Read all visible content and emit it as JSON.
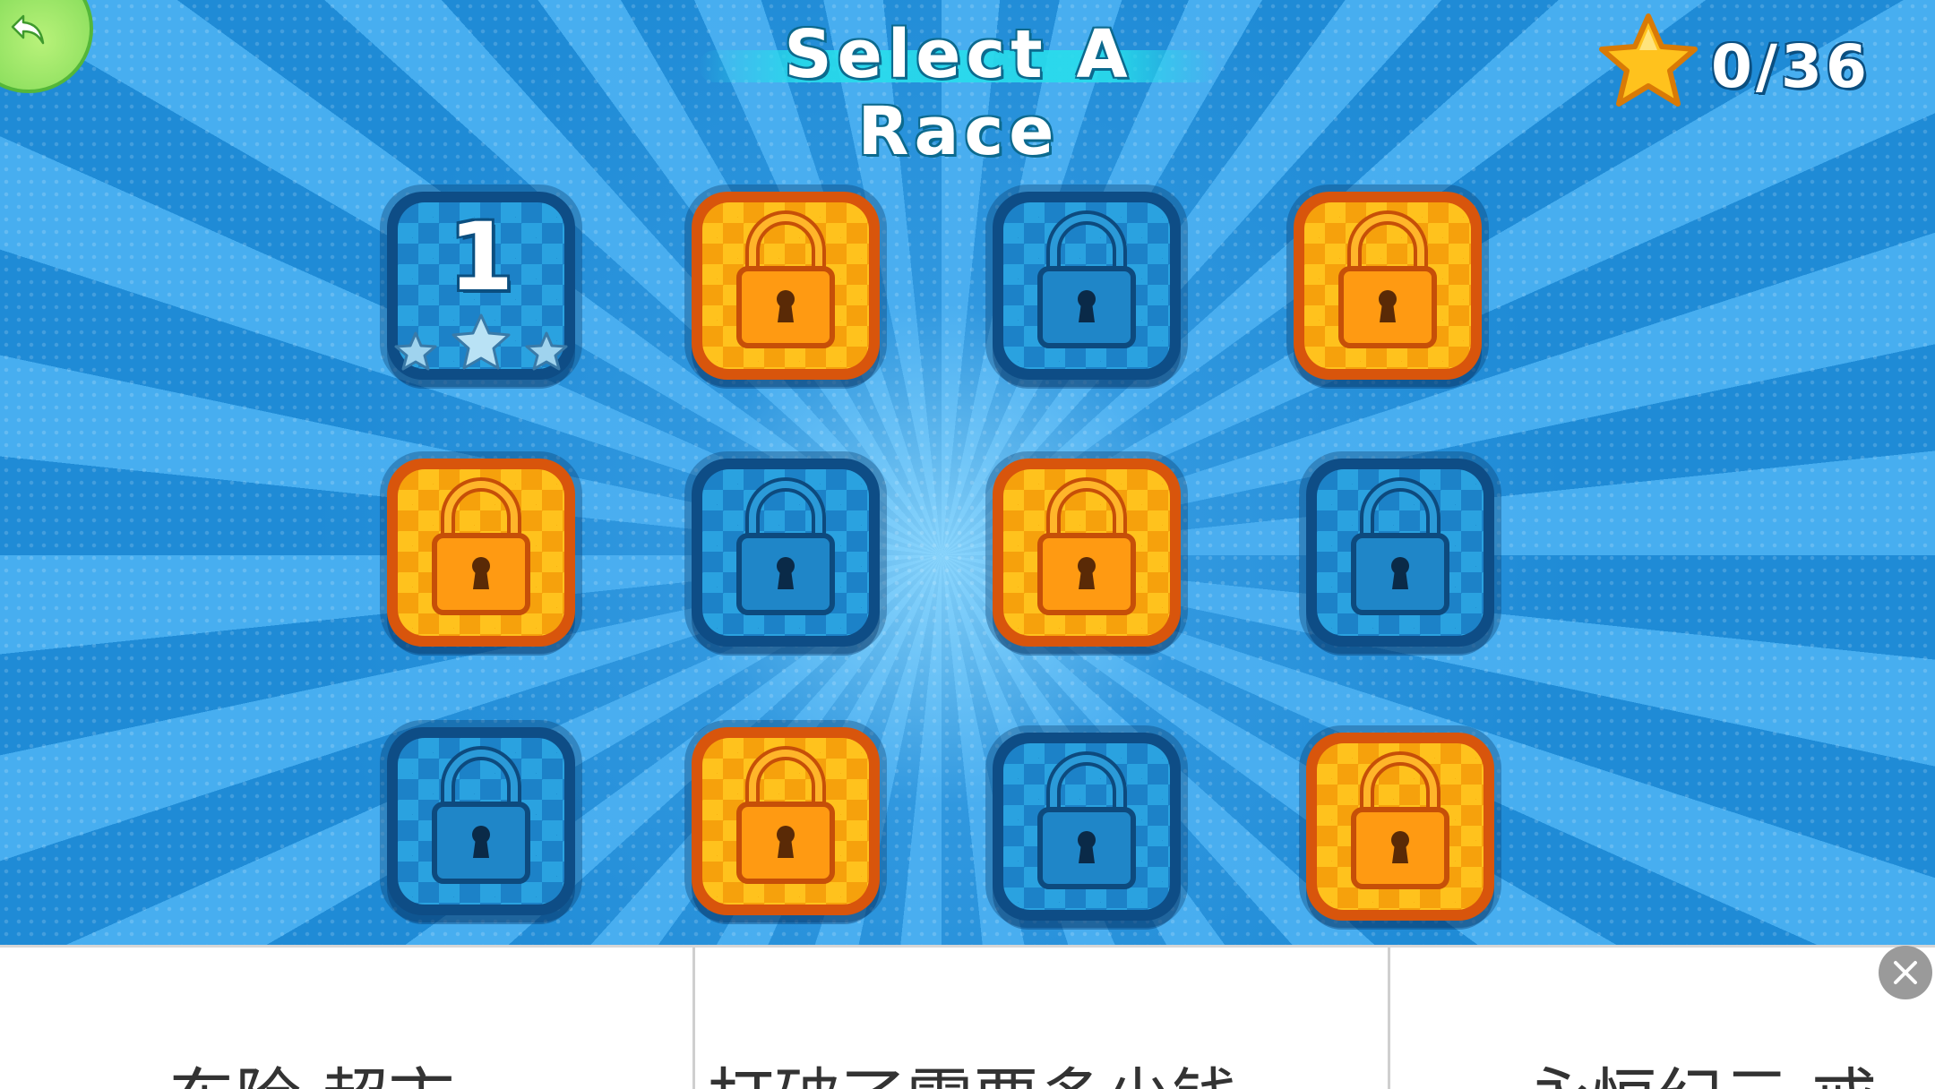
{
  "header": {
    "title": "Select A Race",
    "star_count": "0/36"
  },
  "levels": [
    {
      "label": "1",
      "state": "unlocked",
      "color": "blue",
      "stars_earned": 0,
      "stars_total": 3
    },
    {
      "state": "locked",
      "color": "orange"
    },
    {
      "state": "locked",
      "color": "blue"
    },
    {
      "state": "locked",
      "color": "orange"
    },
    {
      "state": "locked",
      "color": "orange"
    },
    {
      "state": "locked",
      "color": "blue"
    },
    {
      "state": "locked",
      "color": "orange"
    },
    {
      "state": "locked",
      "color": "blue"
    },
    {
      "state": "locked",
      "color": "blue"
    },
    {
      "state": "locked",
      "color": "orange"
    },
    {
      "state": "locked",
      "color": "blue"
    },
    {
      "state": "locked",
      "color": "orange"
    }
  ],
  "ad_banner": {
    "items": [
      "东险 超市",
      "打破了需要多少钱",
      "永恒纪元·戒"
    ]
  },
  "colors": {
    "background_blue": "#1f8fd9",
    "tile_orange": "#f6a10c",
    "tile_blue": "#1c82c8",
    "star_gold": "#ffc21d",
    "back_button_green": "#6fd24b"
  },
  "icons": {
    "back": "back-arrow-icon",
    "star": "star-icon",
    "lock": "padlock-icon",
    "close": "close-icon"
  }
}
